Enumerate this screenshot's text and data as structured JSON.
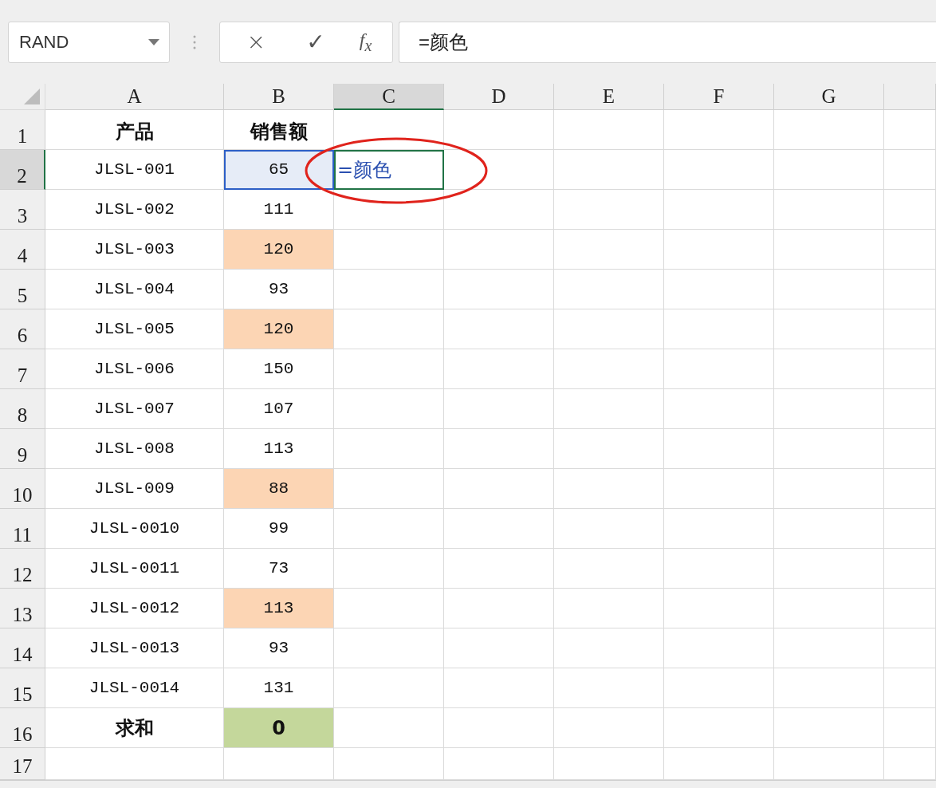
{
  "toolbar": {
    "name_box": "RAND",
    "formula_buttons": [
      "×",
      "✓"
    ],
    "function_label": "f$_{x}$",
    "formula": "=颜色"
  },
  "columns": [
    {
      "label": "A",
      "selected": false
    },
    {
      "label": "B",
      "selected": false
    },
    {
      "label": "C",
      "selected": true
    },
    {
      "label": "D",
      "selected": false
    },
    {
      "label": "E",
      "selected": false
    },
    {
      "label": "F",
      "selected": false
    },
    {
      "label": "G",
      "selected": false
    },
    {
      "selected": false
    }
  ],
  "rows": [
    {
      "number": "1",
      "kind": "header",
      "selected": false,
      "cells": [
        {
          "value": "产品"
        },
        {
          "value": "销售额"
        }
      ]
    },
    {
      "number": "2",
      "kind": "data",
      "selected": true,
      "cells": [
        {
          "value": "JLSL-001"
        },
        {
          "value": "65",
          "selected": true
        },
        {
          "value": "=颜色",
          "editing": true,
          "circled": true
        }
      ]
    },
    {
      "number": "3",
      "kind": "data",
      "selected": false,
      "cells": [
        {
          "value": "JLSL-002"
        },
        {
          "value": "111"
        }
      ]
    },
    {
      "number": "4",
      "kind": "data",
      "selected": false,
      "cells": [
        {
          "value": "JLSL-003"
        },
        {
          "value": "120",
          "color": "#fcd5b4"
        }
      ]
    },
    {
      "number": "5",
      "kind": "data",
      "selected": false,
      "cells": [
        {
          "value": "JLSL-004"
        },
        {
          "value": "93"
        }
      ]
    },
    {
      "number": "6",
      "kind": "data",
      "selected": false,
      "cells": [
        {
          "value": "JLSL-005"
        },
        {
          "value": "120",
          "color": "#fcd5b4"
        }
      ]
    },
    {
      "number": "7",
      "kind": "data",
      "selected": false,
      "cells": [
        {
          "value": "JLSL-006"
        },
        {
          "value": "150"
        }
      ]
    },
    {
      "number": "8",
      "kind": "data",
      "selected": false,
      "cells": [
        {
          "value": "JLSL-007"
        },
        {
          "value": "107"
        }
      ]
    },
    {
      "number": "9",
      "kind": "data",
      "selected": false,
      "cells": [
        {
          "value": "JLSL-008"
        },
        {
          "value": "113"
        }
      ]
    },
    {
      "number": "10",
      "kind": "data",
      "selected": false,
      "cells": [
        {
          "value": "JLSL-009"
        },
        {
          "value": "88",
          "color": "#fcd5b4"
        }
      ]
    },
    {
      "number": "11",
      "kind": "data",
      "selected": false,
      "cells": [
        {
          "value": "JLSL-0010"
        },
        {
          "value": "99"
        }
      ]
    },
    {
      "number": "12",
      "kind": "data",
      "selected": false,
      "cells": [
        {
          "value": "JLSL-0011"
        },
        {
          "value": "73"
        }
      ]
    },
    {
      "number": "13",
      "kind": "data",
      "selected": false,
      "cells": [
        {
          "value": "JLSL-0012"
        },
        {
          "value": "113",
          "color": "#fcd5b4"
        }
      ]
    },
    {
      "number": "14",
      "kind": "data",
      "selected": false,
      "cells": [
        {
          "value": "JLSL-0013"
        },
        {
          "value": "93"
        }
      ]
    },
    {
      "number": "15",
      "kind": "data",
      "selected": false,
      "cells": [
        {
          "value": "JLSL-0014"
        },
        {
          "value": "131"
        }
      ]
    },
    {
      "number": "16",
      "kind": "total",
      "selected": false,
      "cells": [
        {
          "value": "求和"
        },
        {
          "value": "0",
          "color": "#c4d79b"
        }
      ]
    },
    {
      "number": "17",
      "kind": "data",
      "selected": false,
      "cells": []
    }
  ]
}
